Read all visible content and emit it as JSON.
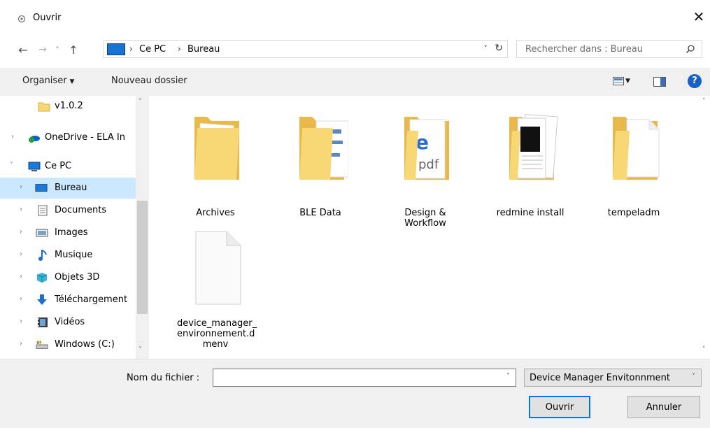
{
  "window": {
    "title": "Ouvrir",
    "close_glyph": "✕"
  },
  "nav": {
    "back_glyph": "←",
    "forward_glyph": "→",
    "recent_glyph": "˅",
    "up_glyph": "↑"
  },
  "address": {
    "crumbs": [
      "Ce PC",
      "Bureau"
    ],
    "separator": "›",
    "dropdown_glyph": "˅",
    "refresh_glyph": "↻"
  },
  "search": {
    "placeholder": "Rechercher dans : Bureau"
  },
  "commandbar": {
    "organize": "Organiser",
    "organize_arrow": "▼",
    "new_folder": "Nouveau dossier",
    "view_arrow": "▼",
    "help": "?"
  },
  "navpane": {
    "items": [
      {
        "label": "v1.0.2",
        "icon": "folder-icon",
        "expandable": false
      },
      {
        "label": "OneDrive - ELA In",
        "icon": "onedrive-icon",
        "expandable": true
      },
      {
        "label": "Ce PC",
        "icon": "pc-icon",
        "expandable": true,
        "expanded": true
      },
      {
        "label": "Bureau",
        "icon": "desktop-icon",
        "expandable": true,
        "selected": true
      },
      {
        "label": "Documents",
        "icon": "documents-icon",
        "expandable": true
      },
      {
        "label": "Images",
        "icon": "images-icon",
        "expandable": true
      },
      {
        "label": "Musique",
        "icon": "music-icon",
        "expandable": true
      },
      {
        "label": "Objets 3D",
        "icon": "3d-objects-icon",
        "expandable": true
      },
      {
        "label": "Téléchargement",
        "icon": "downloads-icon",
        "expandable": true
      },
      {
        "label": "Vidéos",
        "icon": "videos-icon",
        "expandable": true
      },
      {
        "label": "Windows (C:)",
        "icon": "drive-icon",
        "expandable": true
      }
    ],
    "chevron_right": "›",
    "chevron_down": "˅",
    "scroll_up": "˄",
    "scroll_down": "˅"
  },
  "files": [
    {
      "name": "Archives",
      "type": "folder"
    },
    {
      "name": "BLE Data",
      "type": "folder"
    },
    {
      "name": "Design & Workflow",
      "type": "folder"
    },
    {
      "name": "redmine install",
      "type": "folder"
    },
    {
      "name": "tempeladm",
      "type": "folder"
    },
    {
      "name": "device_manager_environnement.dmenv",
      "type": "file"
    }
  ],
  "file_labels": {
    "archives": [
      "Archives"
    ],
    "ble": [
      "BLE Data"
    ],
    "design": [
      "Design &",
      "Workflow"
    ],
    "redmine": [
      "redmine install"
    ],
    "tempeladm": [
      "tempeladm"
    ],
    "dmenv": [
      "device_manager_",
      "environnement.d",
      "menv"
    ]
  },
  "main_scroll": {
    "up": "˄",
    "down": "˅"
  },
  "bottom": {
    "filename_label": "Nom du fichier :",
    "filename_value": "",
    "filename_dd": "˅",
    "filter": "Device Manager Envitonnment",
    "filter_dd": "˅",
    "open": "Ouvrir",
    "cancel": "Annuler"
  },
  "colors": {
    "selected": "#cce8ff",
    "folder": "#f5d06b",
    "accent": "#0078d7"
  }
}
